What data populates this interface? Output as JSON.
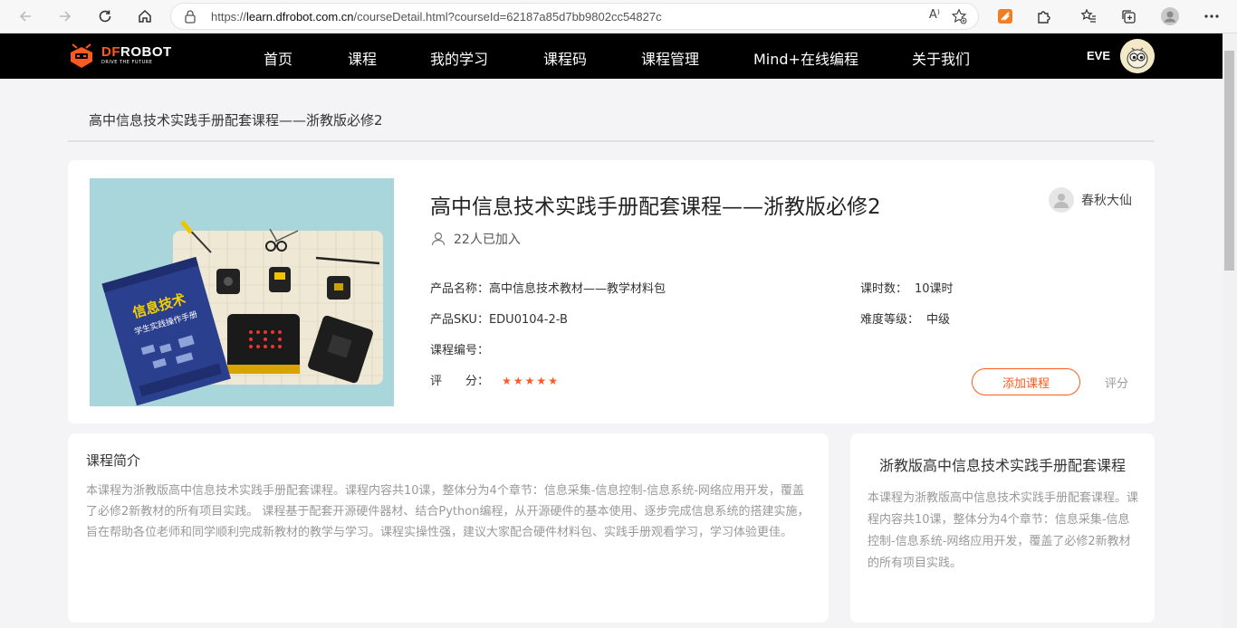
{
  "browser": {
    "url_prefix": "https://",
    "url_domain": "learn.dfrobot.com.cn",
    "url_path": "/courseDetail.html?courseId=62187a85d7bb9802cc54827c",
    "read_aloud_label": "A⁾"
  },
  "header": {
    "logo_prefix": "DF",
    "logo_suffix": "ROBOT",
    "logo_tagline": "DRIVE THE FUTURE",
    "nav": [
      "首页",
      "课程",
      "我的学习",
      "课程码",
      "课程管理",
      "Mind+在线编程",
      "关于我们"
    ],
    "user_name": "EVE"
  },
  "breadcrumb": "高中信息技术实践手册配套课程——浙教版必修2",
  "course": {
    "title": "高中信息技术实践手册配套课程——浙教版必修2",
    "joined": "22人已加入",
    "author": "春秋大仙",
    "product_name_label": "产品名称：",
    "product_name": "高中信息技术教材——教学材料包",
    "sku_label": "产品SKU：",
    "sku": "EDU0104-2-B",
    "code_label": "课程编号：",
    "code": "",
    "rating_label": "评　　分：",
    "rating": 5,
    "rating_stars": "★★★★★",
    "lessons_label": "课时数：",
    "lessons": "10课时",
    "level_label": "难度等级：",
    "level": "中级",
    "add_button": "添加课程",
    "rate_link": "评分"
  },
  "intro": {
    "title": "课程简介",
    "text": "本课程为浙教版高中信息技术实践手册配套课程。课程内容共10课，整体分为4个章节：信息采集-信息控制-信息系统-网络应用开发，覆盖了必修2新教材的所有项目实践。 课程基于配套开源硬件器材、结合Python编程，从开源硬件的基本使用、逐步完成信息系统的搭建实施，旨在帮助各位老师和同学顺利完成新教材的教学与学习。课程实操性强，建议大家配合硬件材料包、实践手册观看学习，学习体验更佳。"
  },
  "side": {
    "title": "浙教版高中信息技术实践手册配套课程",
    "text": "本课程为浙教版高中信息技术实践手册配套课程。课程内容共10课，整体分为4个章节：信息采集-信息控制-信息系统-网络应用开发，覆盖了必修2新教材的所有项目实践。"
  },
  "thumbnail": {
    "book_title": "信息技术",
    "book_subtitle": "学生实践操作手册"
  },
  "colors": {
    "accent": "#ff5a1f",
    "header_bg": "#000000",
    "thumb_bg": "#a9d6da"
  }
}
